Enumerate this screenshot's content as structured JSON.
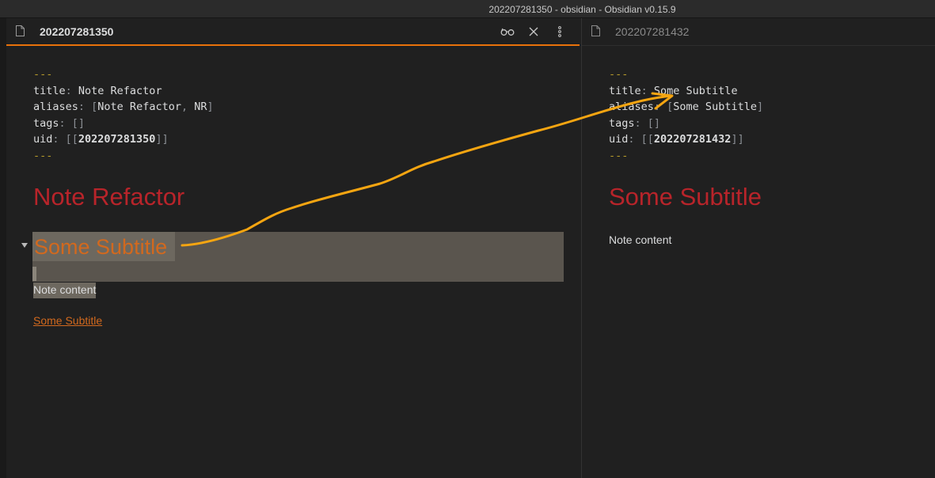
{
  "window": {
    "title": "202207281350 - obsidian - Obsidian v0.15.9"
  },
  "colors": {
    "accent": "#e8710a",
    "heading1": "#b8242a",
    "heading2": "#d2691e",
    "link": "#d2691e",
    "annotation_arrow": "#f5a511"
  },
  "left_pane": {
    "tab_title": "202207281350",
    "icons": {
      "file": "file-icon",
      "reading_view": "reading-view-glasses-icon",
      "close": "close-icon",
      "more": "more-options-icon"
    },
    "frontmatter": {
      "open": "---",
      "title_key": "title",
      "title_value": "Note Refactor",
      "aliases_key": "aliases",
      "aliases_value_1": "Note Refactor",
      "aliases_value_2": "NR",
      "tags_key": "tags",
      "tags_value": "[]",
      "uid_key": "uid",
      "uid_value": "202207281350",
      "close": "---"
    },
    "h1": "Note Refactor",
    "h2": "Some Subtitle",
    "note_content": "Note content",
    "link_text": "Some Subtitle"
  },
  "right_pane": {
    "tab_title": "202207281432",
    "icons": {
      "file": "file-icon"
    },
    "frontmatter": {
      "open": "---",
      "title_key": "title",
      "title_value": "Some Subtitle",
      "aliases_key": "aliases",
      "aliases_value_1": "Some Subtitle",
      "tags_key": "tags",
      "tags_value": "[]",
      "uid_key": "uid",
      "uid_value": "202207281432",
      "close": "---"
    },
    "h1": "Some Subtitle",
    "note_content": "Note content"
  }
}
